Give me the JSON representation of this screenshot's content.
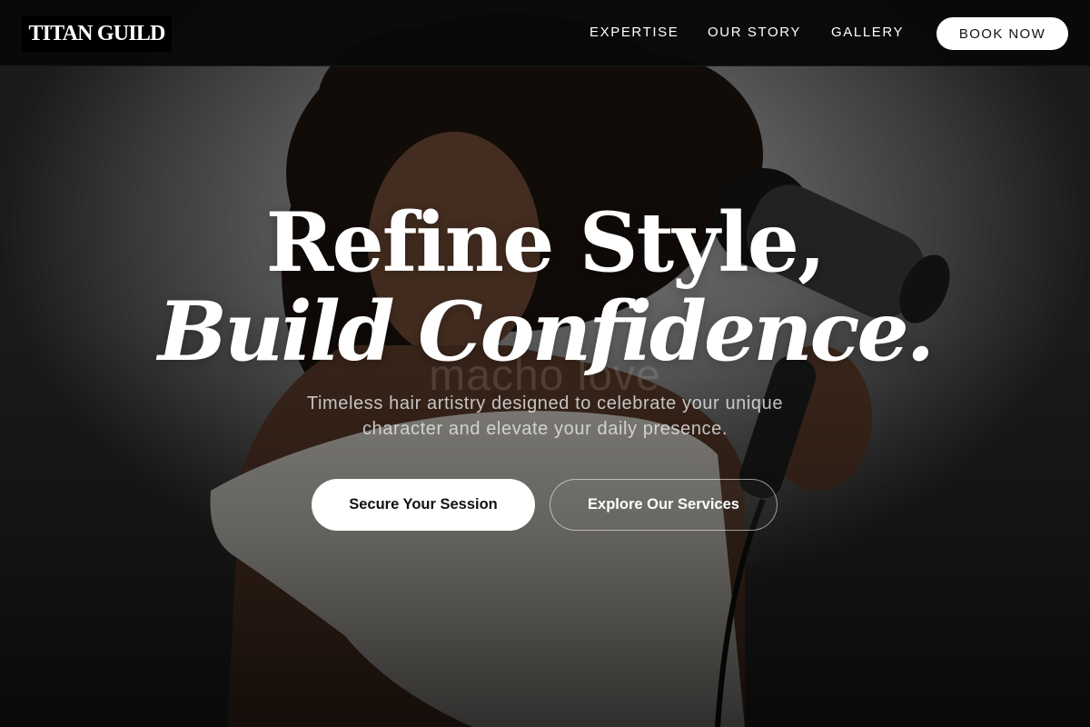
{
  "brand": {
    "logo_text": "TITAN GUILD"
  },
  "nav": {
    "links": [
      "EXPERTISE",
      "OUR STORY",
      "GALLERY"
    ],
    "book_label": "BOOK NOW"
  },
  "hero": {
    "headline_line1": "Refine Style,",
    "headline_line2": "Build Confidence.",
    "watermark": "macho love",
    "subtitle": "Timeless hair artistry designed to celebrate your unique character and elevate your daily presence.",
    "primary_cta": "Secure Your Session",
    "secondary_cta": "Explore Our Services"
  },
  "colors": {
    "navbar_bg": "#080808",
    "button_bg": "#ffffff",
    "button_text": "#111111",
    "text": "#ffffff"
  }
}
